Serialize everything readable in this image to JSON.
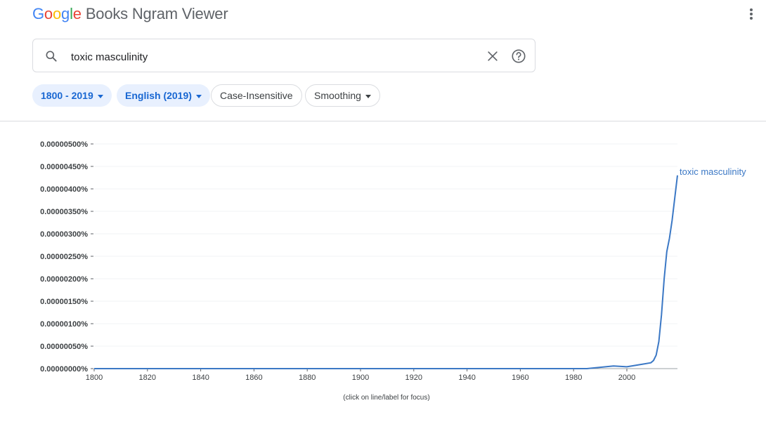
{
  "header": {
    "logo_letters": [
      "G",
      "o",
      "o",
      "g",
      "l",
      "e"
    ],
    "app_title": "Books Ngram Viewer",
    "menu_icon": "more-vert-icon"
  },
  "search": {
    "value": "toxic masculinity",
    "icons": {
      "search": "search-icon",
      "clear": "close-icon",
      "help": "help-icon"
    }
  },
  "filters": {
    "year_range": "1800 - 2019",
    "corpus": "English (2019)",
    "case": "Case-Insensitive",
    "smoothing": "Smoothing"
  },
  "colors": {
    "accent": "#1967d2",
    "series": "#3b78c5",
    "chip_bg": "#e8f0fe"
  },
  "chart_data": {
    "type": "line",
    "xlim": [
      1800,
      2019
    ],
    "ylim": [
      0,
      5e-06
    ],
    "x_ticks": [
      "1800",
      "1820",
      "1840",
      "1860",
      "1880",
      "1900",
      "1920",
      "1940",
      "1960",
      "1980",
      "2000"
    ],
    "y_ticks": [
      "0.00000000%",
      "0.00000050%",
      "0.00000100%",
      "0.00000150%",
      "0.00000200%",
      "0.00000250%",
      "0.00000300%",
      "0.00000350%",
      "0.00000400%",
      "0.00000450%",
      "0.00000500%"
    ],
    "grid": true,
    "series": [
      {
        "name": "toxic masculinity",
        "x": [
          1800,
          1985,
          1990,
          1995,
          2000,
          2003,
          2006,
          2009,
          2010,
          2011,
          2012,
          2013,
          2014,
          2015,
          2016,
          2017,
          2018,
          2019
        ],
        "y": [
          0,
          0,
          3e-08,
          6e-08,
          4e-08,
          7e-08,
          1e-07,
          1.3e-07,
          1.8e-07,
          3e-07,
          6e-07,
          1.2e-06,
          2e-06,
          2.6e-06,
          2.9e-06,
          3.3e-06,
          3.8e-06,
          4.3e-06
        ]
      }
    ],
    "caption": "(click on line/label for focus)"
  }
}
